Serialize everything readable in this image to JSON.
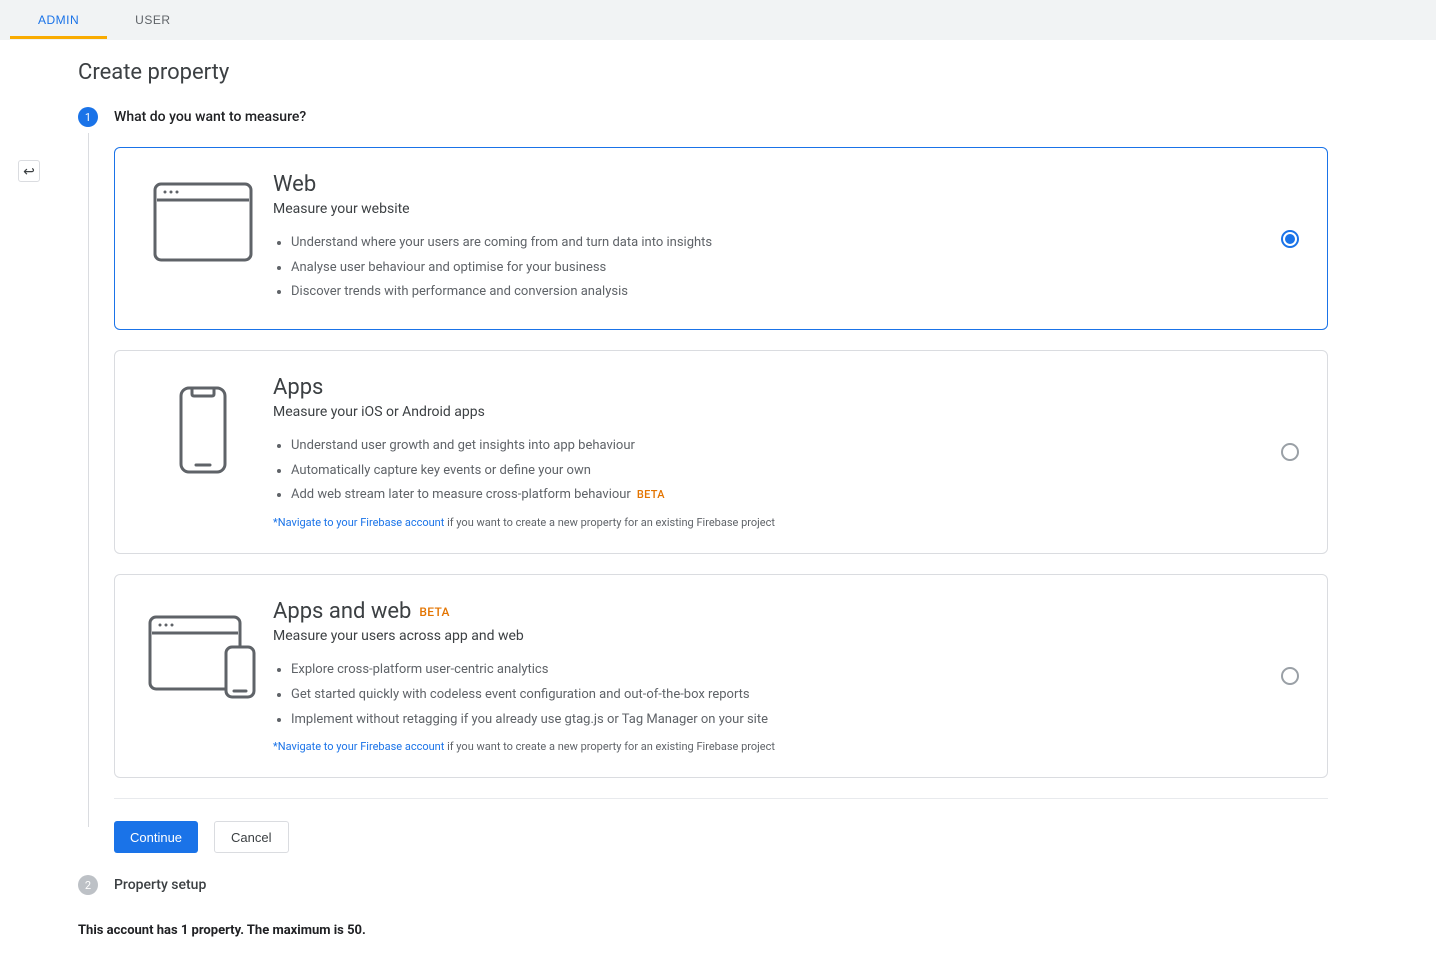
{
  "tabs": {
    "admin": "ADMIN",
    "user": "USER"
  },
  "page_title": "Create property",
  "steps": {
    "s1": {
      "num": "1",
      "label": "What do you want to measure?"
    },
    "s2": {
      "num": "2",
      "label": "Property setup"
    }
  },
  "options": {
    "web": {
      "title": "Web",
      "sub": "Measure your website",
      "bullets": [
        "Understand where your users are coming from and turn data into insights",
        "Analyse user behaviour and optimise for your business",
        "Discover trends with performance and conversion analysis"
      ]
    },
    "apps": {
      "title": "Apps",
      "sub": "Measure your iOS or Android apps",
      "bullets": [
        "Understand user growth and get insights into app behaviour",
        "Automatically capture key events or define your own",
        "Add web stream later to measure cross-platform behaviour"
      ],
      "beta_inline": "BETA",
      "firebase_link": "*Navigate to your Firebase account",
      "firebase_rest": " if you want to create a new property for an existing Firebase project"
    },
    "appsweb": {
      "title": "Apps and web",
      "title_beta": " BETA",
      "sub": "Measure your users across app and web",
      "bullets": [
        "Explore cross-platform user-centric analytics",
        "Get started quickly with codeless event configuration and out-of-the-box reports",
        "Implement without retagging if you already use gtag.js or Tag Manager on your site"
      ],
      "firebase_link": "*Navigate to your Firebase account",
      "firebase_rest": " if you want to create a new property for an existing Firebase project"
    }
  },
  "actions": {
    "continue": "Continue",
    "cancel": "Cancel"
  },
  "account_note": "This account has 1 property. The maximum is 50."
}
